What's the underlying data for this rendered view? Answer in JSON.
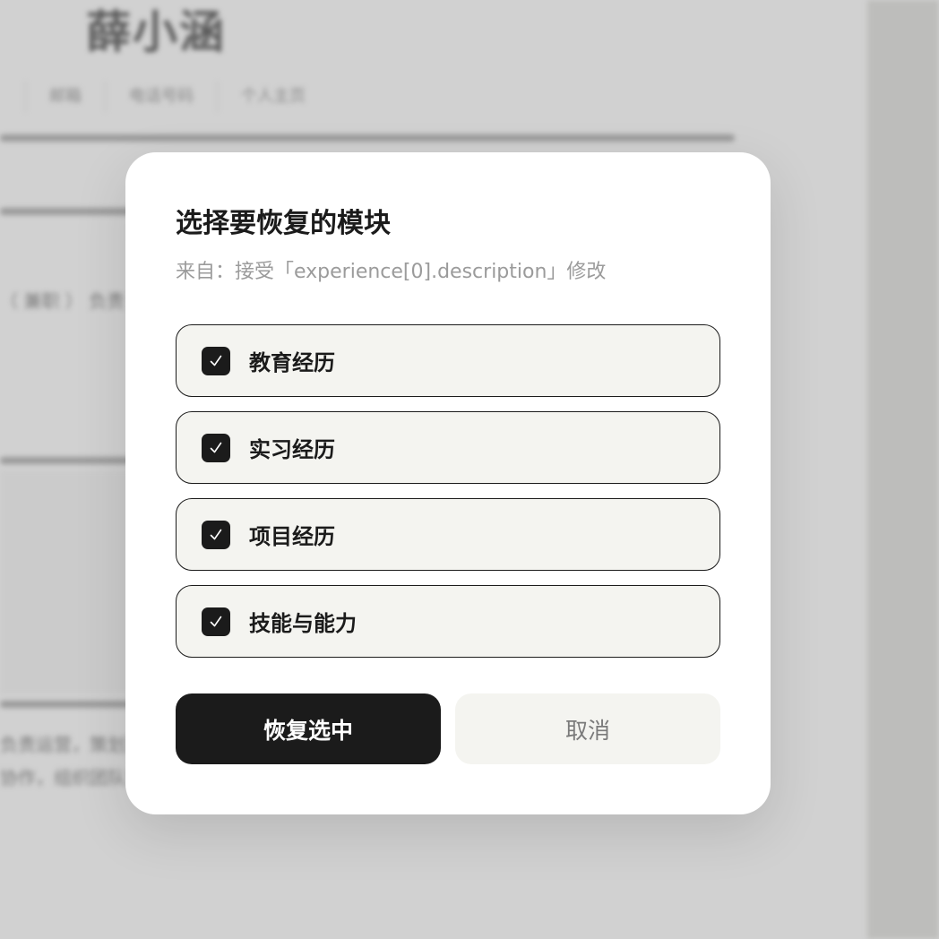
{
  "background": {
    "name": "薛小涵",
    "tabs": [
      "",
      "邮箱",
      "电话号码",
      "个人主页"
    ],
    "text_rows": [
      "（ 兼职 ） 负责",
      "负责运营，策划活动",
      "协作，组织团队完"
    ]
  },
  "modal": {
    "title": "选择要恢复的模块",
    "subtitle": "来自：接受「experience[0].description」修改",
    "options": [
      {
        "label": "教育经历",
        "checked": true
      },
      {
        "label": "实习经历",
        "checked": true
      },
      {
        "label": "项目经历",
        "checked": true
      },
      {
        "label": "技能与能力",
        "checked": true
      }
    ],
    "confirm_label": "恢复选中",
    "cancel_label": "取消"
  },
  "colors": {
    "primary": "#1b1b1b",
    "option_bg": "#f4f4f0",
    "subtitle": "#9b9b9b",
    "overlay": "#d1d1d1"
  }
}
